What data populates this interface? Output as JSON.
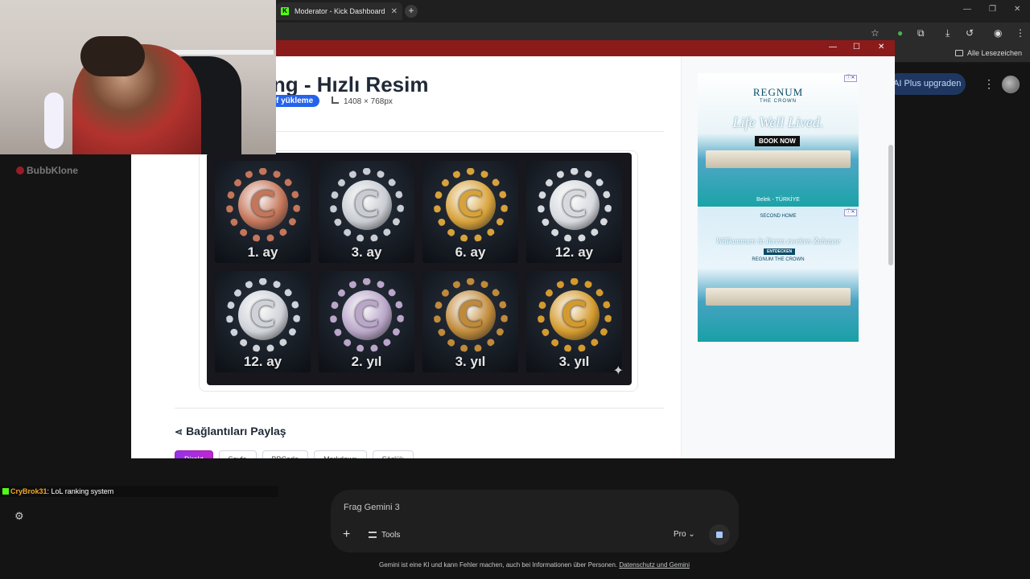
{
  "browser": {
    "tab_title": "Moderator - Kick Dashboard",
    "tab_favicon": "K",
    "bookmarks_label": "Alle Lesezeichen"
  },
  "gemini": {
    "upgrade_label": "AI Plus upgraden",
    "prompt_placeholder": "Frag Gemini 3",
    "tools_label": "Tools",
    "mode_label": "Pro",
    "disclaimer_text": "Gemini ist eine KI und kann Fehler machen, auch bei Informationen über Personen.",
    "disclaimer_link": "Datenschutz und Gemini"
  },
  "stream": {
    "watermark": "BubbKlone",
    "chat_user": "CryBrok31",
    "chat_message": ": LoL ranking system"
  },
  "popup": {
    "title": "png - Hızlı Resim",
    "upload_pill": "f yükleme",
    "dimensions": "1408 × 768px",
    "share_title": "Bağlantıları Paylaş",
    "share_tabs": [
      "Direkt",
      "Sayfa",
      "BBCode",
      "Markdown",
      "Sözlük"
    ],
    "active_tab": "Direkt"
  },
  "badges": [
    {
      "label": "1. ay",
      "metal": "#c4765a"
    },
    {
      "label": "3. ay",
      "metal": "#c9ccd2"
    },
    {
      "label": "6. ay",
      "metal": "#d8a23a"
    },
    {
      "label": "12. ay",
      "metal": "#d6d9de"
    },
    {
      "label": "12. ay",
      "metal": "#cfd2d8"
    },
    {
      "label": "2. yıl",
      "metal": "#b9a6c9"
    },
    {
      "label": "3. yıl",
      "metal": "#c08a3a"
    },
    {
      "label": "3. yıl",
      "metal": "#d49a2e"
    }
  ],
  "ads": {
    "ad1_brand": "REGNUM",
    "ad1_sub": "THE CROWN",
    "ad1_slogan": "Life Well Lived.",
    "ad1_cta": "BOOK NOW",
    "ad1_location": "Belek - TÜRKİYE",
    "ad2_brand": "SECOND HOME",
    "ad2_slogan": "Willkommen in Ihrem zweiten Zuhause",
    "ad2_cta": "ENTDECKEN",
    "ad2_brand_bottom": "REGNUM THE CROWN"
  }
}
